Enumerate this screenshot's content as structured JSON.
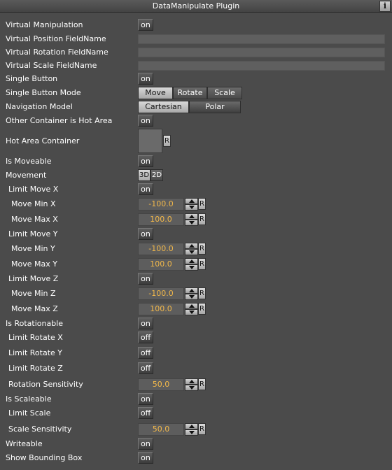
{
  "window": {
    "title": "DataManipulate Plugin",
    "info_label": "i"
  },
  "rows": {
    "virtual_manipulation": {
      "label": "Virtual Manipulation",
      "value": "on"
    },
    "virtual_position": {
      "label": "Virtual Position FieldName",
      "value": ""
    },
    "virtual_rotation": {
      "label": "Virtual Rotation FieldName",
      "value": ""
    },
    "virtual_scale": {
      "label": "Virtual Scale FieldName",
      "value": ""
    },
    "single_button": {
      "label": "Single Button",
      "value": "on"
    },
    "single_button_mode": {
      "label": "Single Button Mode",
      "options": [
        "Move",
        "Rotate",
        "Scale"
      ],
      "selected": "Move"
    },
    "navigation_model": {
      "label": "Navigation Model",
      "options": [
        "Cartesian",
        "Polar"
      ],
      "selected": "Cartesian"
    },
    "other_container_hot": {
      "label": "Other Container is Hot Area",
      "value": "on"
    },
    "hot_area_container": {
      "label": "Hot Area Container",
      "reset": "R"
    },
    "is_moveable": {
      "label": "Is Moveable",
      "value": "on"
    },
    "movement": {
      "label": "Movement",
      "options": [
        "3D",
        "2D"
      ],
      "selected": "3D"
    },
    "limit_move_x": {
      "label": "Limit Move X",
      "value": "on"
    },
    "move_min_x": {
      "label": "Move Min X",
      "value": "-100.0",
      "reset": "R"
    },
    "move_max_x": {
      "label": "Move Max X",
      "value": "100.0",
      "reset": "R"
    },
    "limit_move_y": {
      "label": "Limit Move Y",
      "value": "on"
    },
    "move_min_y": {
      "label": "Move Min Y",
      "value": "-100.0",
      "reset": "R"
    },
    "move_max_y": {
      "label": "Move Max Y",
      "value": "100.0",
      "reset": "R"
    },
    "limit_move_z": {
      "label": "Limit Move Z",
      "value": "on"
    },
    "move_min_z": {
      "label": "Move Min Z",
      "value": "-100.0",
      "reset": "R"
    },
    "move_max_z": {
      "label": "Move Max Z",
      "value": "100.0",
      "reset": "R"
    },
    "is_rotationable": {
      "label": "Is Rotationable",
      "value": "on"
    },
    "limit_rotate_x": {
      "label": "Limit Rotate X",
      "value": "off"
    },
    "limit_rotate_y": {
      "label": "Limit Rotate Y",
      "value": "off"
    },
    "limit_rotate_z": {
      "label": "Limit Rotate Z",
      "value": "off"
    },
    "rotation_sensitivity": {
      "label": "Rotation Sensitivity",
      "value": "50.0",
      "reset": "R"
    },
    "is_scaleable": {
      "label": "Is Scaleable",
      "value": "on"
    },
    "limit_scale": {
      "label": "Limit Scale",
      "value": "off"
    },
    "scale_sensitivity": {
      "label": "Scale Sensitivity",
      "value": "50.0",
      "reset": "R"
    },
    "writeable": {
      "label": "Writeable",
      "value": "on"
    },
    "show_bounding_box": {
      "label": "Show Bounding Box",
      "value": "on"
    }
  },
  "colors": {
    "background": "#4b4b4b",
    "numeric_text": "#f2b84a",
    "selected_segment": "#c4c4c4"
  }
}
